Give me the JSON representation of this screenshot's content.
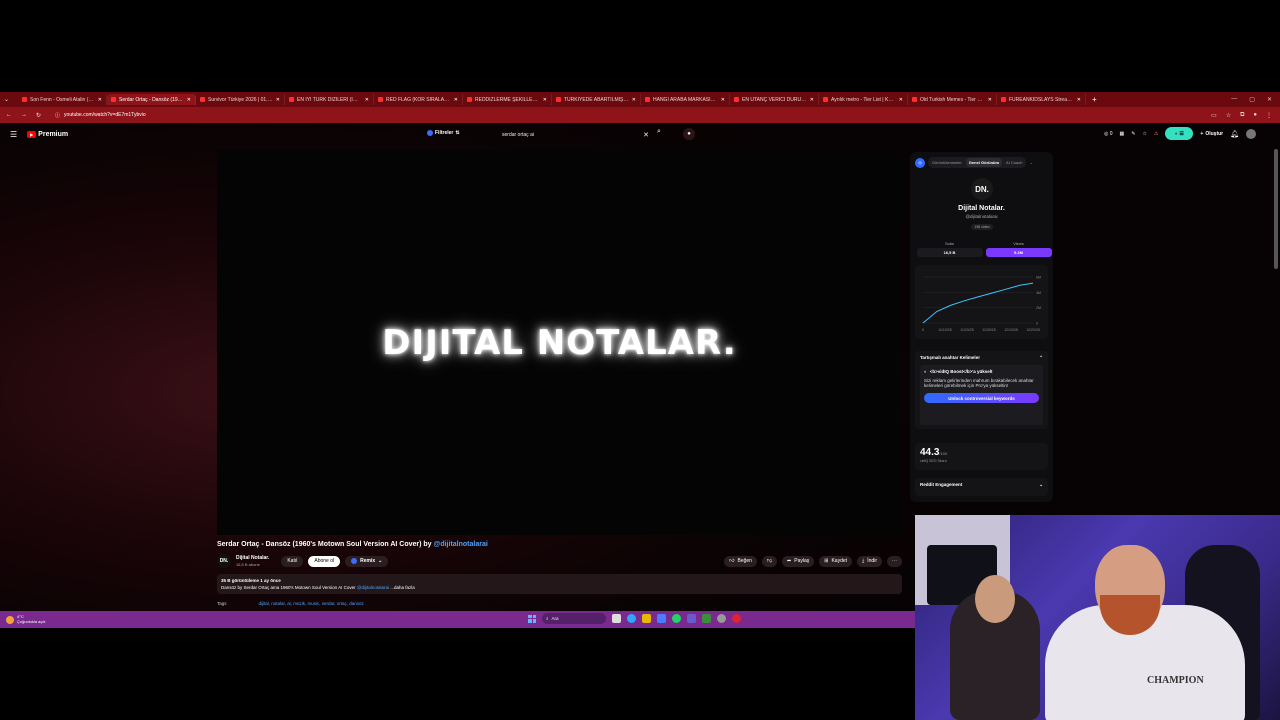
{
  "browser": {
    "tabs": [
      {
        "title": "Son Fenn - Osmeli Atalin (1950",
        "active": false
      },
      {
        "title": "Serdar Ortaç - Dansöz (1960's Mo",
        "active": true
      },
      {
        "title": "Survivor Türkiye 2026 | 01.01.2",
        "active": false
      },
      {
        "title": "EN İYİ TÜRK DİZİLERİ (IMDB) ",
        "active": false
      },
      {
        "title": "RED FLAG (KÖR SIRALAMA) FT.",
        "active": false
      },
      {
        "title": "REDDİZLERME ŞEKİLLERİ (KÖR",
        "active": false
      },
      {
        "title": "TÜRKİYEDE ABARTILMIŞ İÇECEK",
        "active": false
      },
      {
        "title": "HANGİ ARABA MARKASINI SE",
        "active": false
      },
      {
        "title": "EN UTANÇ VERİCİ DURUMLAR",
        "active": false
      },
      {
        "title": "Ayrılık metro - Tier List | Kör Sı",
        "active": false
      },
      {
        "title": "Old Turkish Memes - Tier List",
        "active": false
      },
      {
        "title": "FUREANKIDSLAYS Stream - Wa",
        "active": false
      }
    ],
    "url": "youtube.com/watch?v=dE7m1Tybvio"
  },
  "youtube": {
    "logo_text": "Premium",
    "filters_label": "Filtreler",
    "search_value": "serdar ortaç ai",
    "create_label": "Oluştur",
    "video_overlay_text": "DIJITAL NOTALAR.",
    "title_main": "Serdar Ortaç - Dansöz (1960's Motown Soul Version AI Cover) by ",
    "title_link": "@dijitalnotalarai",
    "channel": {
      "avatar_text": "DN.",
      "name": "Dijital Notalar.",
      "subs": "16,5 B abone",
      "join_label": "Katıl",
      "subscribe_label": "Abone ol",
      "remix_label": "Remix"
    },
    "actions": {
      "like": "Beğen",
      "share": "Paylaş",
      "save": "Kaydet",
      "download": "İndir"
    },
    "description": {
      "meta": "35 B görüntüleme  1 ay önce",
      "text": "Dansöz by Serdar Ortaç ama 1960's Motown Soul Version AI Cover ",
      "link": "@dijitalnotalarai",
      "more": " ...daha fazla"
    },
    "tags_label": "Tags",
    "tags": "dijital, notalar, ai, müzik, music, serdar, ortaç, dansöz"
  },
  "vidiq": {
    "tabs": [
      "Görüntülenmeler",
      "Genel Görünüm",
      "AI Coach"
    ],
    "active_tab": 1,
    "avatar_text": "DN.",
    "channel_name": "Dijital Notalar.",
    "handle": "@dijitalnotalarai",
    "age": "196 video",
    "subs_label": "Subs",
    "subs_value": "16,5 B",
    "views_label": "Views",
    "views_value": "5.2M",
    "keywords_title": "Tartışmalı anahtar Kelimeler",
    "boost_label": "<b>vidIQ Boost</b>'a yükselt",
    "keywords_text": "Sizi reklam gelirlerinden mahrum bırakabilecek anahtar kelimeleri görebilmek için Pro'ya yükseltin!",
    "unlock_label": "Unlock controversial keywords",
    "seo_score": "44.3",
    "seo_max": "/100",
    "seo_label": "vidIQ SEO Skoru",
    "reddit_title": "Reddit Engagement",
    "chart_data": {
      "type": "line",
      "x": [
        "0",
        "11/10/25",
        "11/20/25",
        "11/30/25",
        "12/10/25",
        "12/20/25"
      ],
      "values": [
        0,
        1.5,
        2.3,
        2.9,
        3.4,
        3.9,
        4.4,
        4.9,
        5.2
      ],
      "yticks": [
        "6M",
        "4M",
        "2M",
        "0"
      ],
      "color": "#3bc4ff"
    }
  },
  "taskbar": {
    "temp": "4°C",
    "weather": "Çoğunlukla açık",
    "search_label": "Ara"
  },
  "webcam": {
    "hoodie_text": "CHAMPION"
  }
}
